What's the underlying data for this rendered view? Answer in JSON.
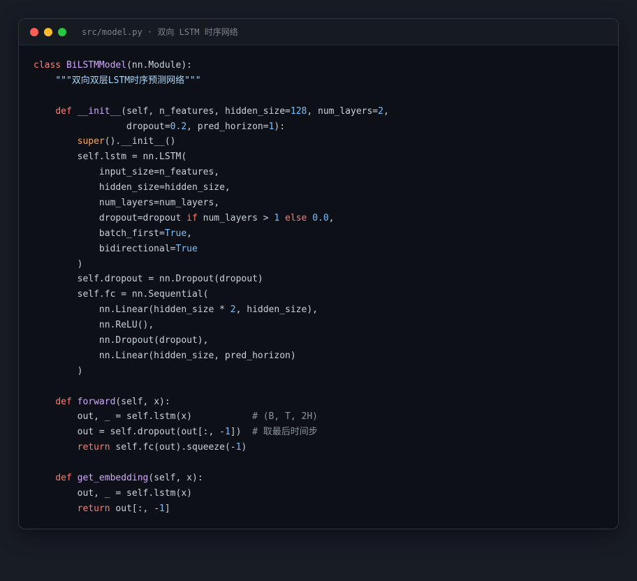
{
  "window": {
    "title": "src/model.py · 双向 LSTM 时序网络"
  },
  "code": {
    "lines": [
      [
        {
          "t": "class ",
          "c": "kw"
        },
        {
          "t": "BiLSTMModel",
          "c": "cls"
        },
        {
          "t": "(nn.Module):",
          "c": ""
        }
      ],
      [
        {
          "t": "    ",
          "c": ""
        },
        {
          "t": "\"\"\"双向双层LSTM时序预测网络\"\"\"",
          "c": "str"
        }
      ],
      [],
      [
        {
          "t": "    ",
          "c": ""
        },
        {
          "t": "def ",
          "c": "kw"
        },
        {
          "t": "__init__",
          "c": "fn"
        },
        {
          "t": "(self, n_features, hidden_size=",
          "c": ""
        },
        {
          "t": "128",
          "c": "num"
        },
        {
          "t": ", num_layers=",
          "c": ""
        },
        {
          "t": "2",
          "c": "num"
        },
        {
          "t": ",",
          "c": ""
        }
      ],
      [
        {
          "t": "                 dropout=",
          "c": ""
        },
        {
          "t": "0.2",
          "c": "num"
        },
        {
          "t": ", pred_horizon=",
          "c": ""
        },
        {
          "t": "1",
          "c": "num"
        },
        {
          "t": "):",
          "c": ""
        }
      ],
      [
        {
          "t": "        ",
          "c": ""
        },
        {
          "t": "super",
          "c": "bi"
        },
        {
          "t": "().__init__()",
          "c": ""
        }
      ],
      [
        {
          "t": "        self.lstm = nn.LSTM(",
          "c": ""
        }
      ],
      [
        {
          "t": "            input_size=n_features,",
          "c": ""
        }
      ],
      [
        {
          "t": "            hidden_size=hidden_size,",
          "c": ""
        }
      ],
      [
        {
          "t": "            num_layers=num_layers,",
          "c": ""
        }
      ],
      [
        {
          "t": "            dropout=dropout ",
          "c": ""
        },
        {
          "t": "if",
          "c": "kw"
        },
        {
          "t": " num_layers > ",
          "c": ""
        },
        {
          "t": "1",
          "c": "num"
        },
        {
          "t": " ",
          "c": ""
        },
        {
          "t": "else",
          "c": "kw"
        },
        {
          "t": " ",
          "c": ""
        },
        {
          "t": "0.0",
          "c": "num"
        },
        {
          "t": ",",
          "c": ""
        }
      ],
      [
        {
          "t": "            batch_first=",
          "c": ""
        },
        {
          "t": "True",
          "c": "const"
        },
        {
          "t": ",",
          "c": ""
        }
      ],
      [
        {
          "t": "            bidirectional=",
          "c": ""
        },
        {
          "t": "True",
          "c": "const"
        }
      ],
      [
        {
          "t": "        )",
          "c": ""
        }
      ],
      [
        {
          "t": "        self.dropout = nn.Dropout(dropout)",
          "c": ""
        }
      ],
      [
        {
          "t": "        self.fc = nn.Sequential(",
          "c": ""
        }
      ],
      [
        {
          "t": "            nn.Linear(hidden_size * ",
          "c": ""
        },
        {
          "t": "2",
          "c": "num"
        },
        {
          "t": ", hidden_size),",
          "c": ""
        }
      ],
      [
        {
          "t": "            nn.ReLU(),",
          "c": ""
        }
      ],
      [
        {
          "t": "            nn.Dropout(dropout),",
          "c": ""
        }
      ],
      [
        {
          "t": "            nn.Linear(hidden_size, pred_horizon)",
          "c": ""
        }
      ],
      [
        {
          "t": "        )",
          "c": ""
        }
      ],
      [],
      [
        {
          "t": "    ",
          "c": ""
        },
        {
          "t": "def ",
          "c": "kw"
        },
        {
          "t": "forward",
          "c": "fn"
        },
        {
          "t": "(self, x):",
          "c": ""
        }
      ],
      [
        {
          "t": "        out, _ = self.lstm(x)           ",
          "c": ""
        },
        {
          "t": "# (B, T, 2H)",
          "c": "cmt"
        }
      ],
      [
        {
          "t": "        out = self.dropout(out[:, -",
          "c": ""
        },
        {
          "t": "1",
          "c": "num"
        },
        {
          "t": "])  ",
          "c": ""
        },
        {
          "t": "# 取最后时间步",
          "c": "cmt"
        }
      ],
      [
        {
          "t": "        ",
          "c": ""
        },
        {
          "t": "return",
          "c": "kw"
        },
        {
          "t": " self.fc(out).squeeze(-",
          "c": ""
        },
        {
          "t": "1",
          "c": "num"
        },
        {
          "t": ")",
          "c": ""
        }
      ],
      [],
      [
        {
          "t": "    ",
          "c": ""
        },
        {
          "t": "def ",
          "c": "kw"
        },
        {
          "t": "get_embedding",
          "c": "fn"
        },
        {
          "t": "(self, x):",
          "c": ""
        }
      ],
      [
        {
          "t": "        out, _ = self.lstm(x)",
          "c": ""
        }
      ],
      [
        {
          "t": "        ",
          "c": ""
        },
        {
          "t": "return",
          "c": "kw"
        },
        {
          "t": " out[:, -",
          "c": ""
        },
        {
          "t": "1",
          "c": "num"
        },
        {
          "t": "]",
          "c": ""
        }
      ]
    ]
  }
}
